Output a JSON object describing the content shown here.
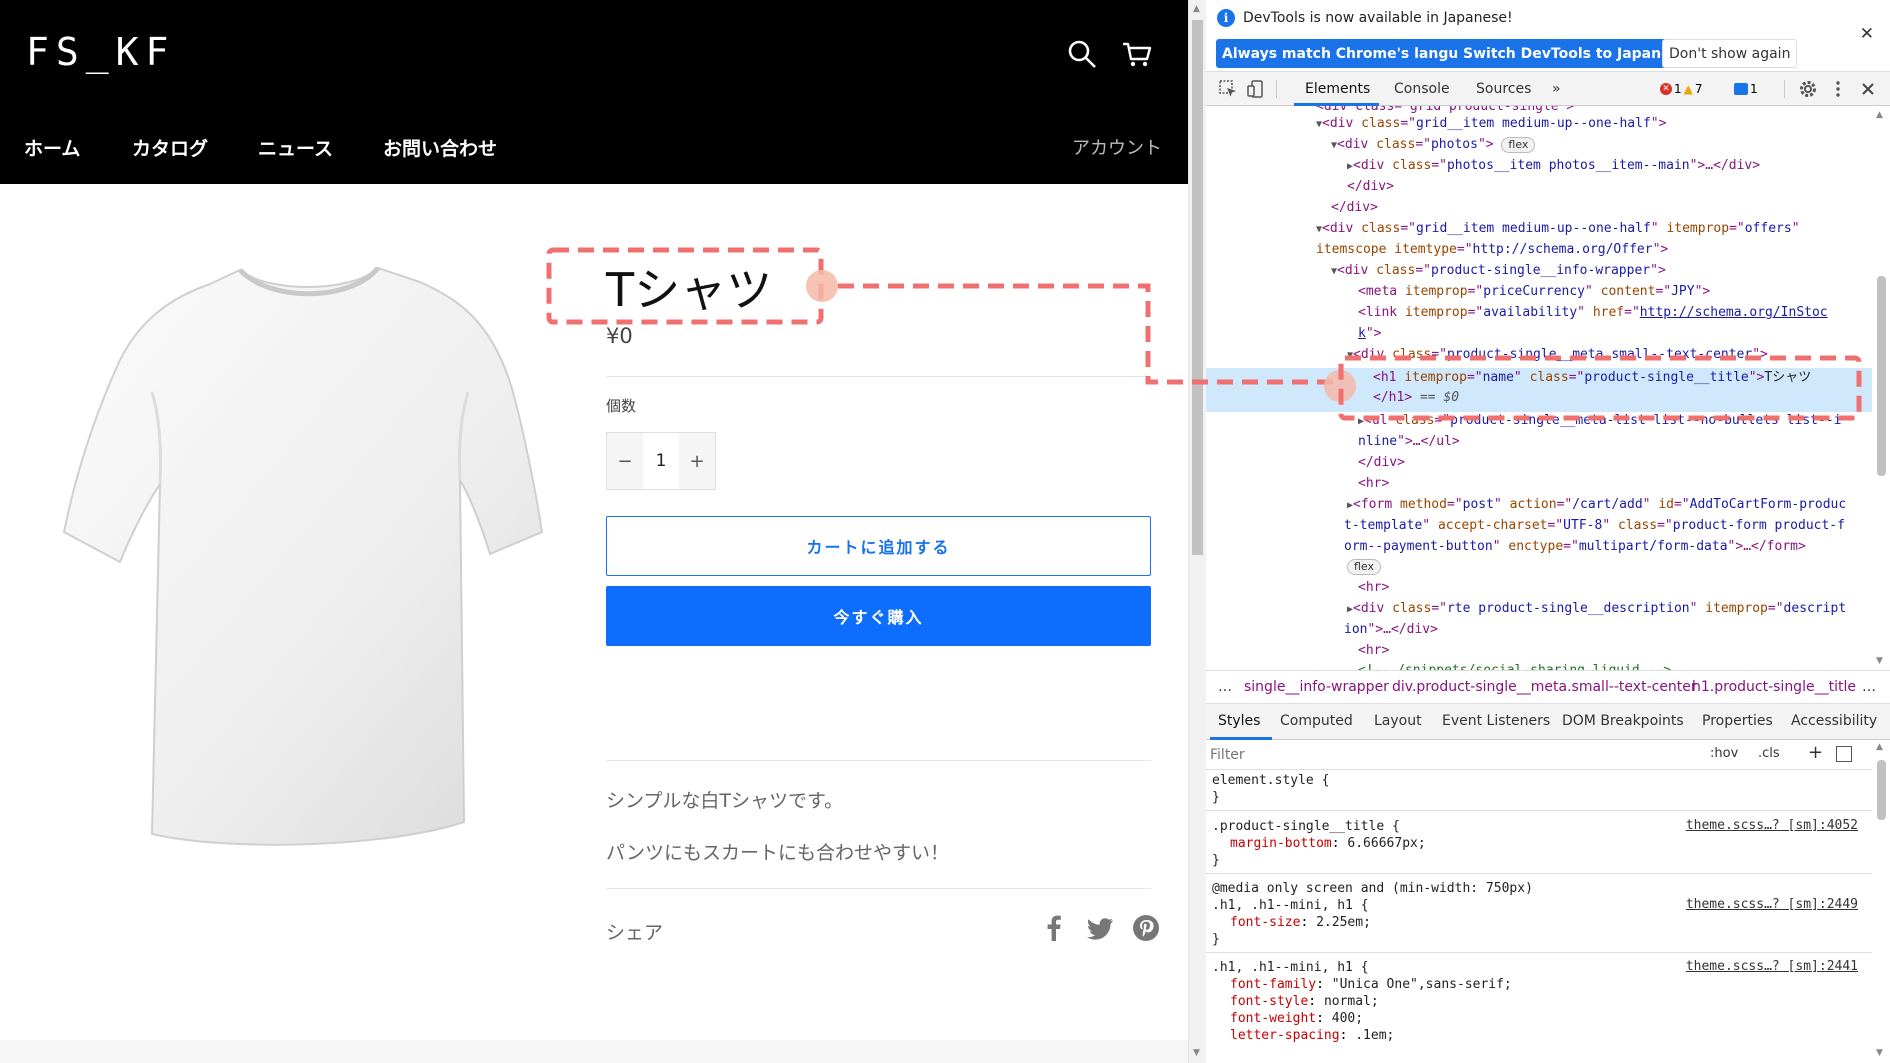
{
  "store": {
    "logo": "FS_KF",
    "nav": [
      "ホーム",
      "カタログ",
      "ニュース",
      "お問い合わせ"
    ],
    "account": "アカウント",
    "product": {
      "title": "Tシャツ",
      "price": "¥0",
      "quantity_label": "個数",
      "quantity_minus": "−",
      "quantity_value": "1",
      "quantity_plus": "+",
      "add_to_cart": "カートに追加する",
      "buy_now": "今すぐ購入",
      "description_1": "シンプルな白Tシャツです。",
      "description_2": "パンツにもスカートにも合わせやすい！",
      "share_label": "シェア"
    }
  },
  "devtools": {
    "infobar": {
      "message": "DevTools is now available in Japanese!",
      "buttons": [
        "Always match Chrome's language",
        "Switch DevTools to Japanese",
        "Don't show again"
      ]
    },
    "tabs": [
      "Elements",
      "Console",
      "Sources",
      "»"
    ],
    "badges": {
      "errors": "1",
      "warnings": "7",
      "messages": "1"
    },
    "breadcrumbs": [
      "…",
      "single__info-wrapper",
      "div.product-single__meta.small--text-center",
      "h1.product-single__title",
      "…"
    ],
    "sub_tabs": [
      "Styles",
      "Computed",
      "Layout",
      "Event Listeners",
      "DOM Breakpoints",
      "Properties",
      "Accessibility"
    ],
    "filter_placeholder": "Filter",
    "filter_tools": [
      ":hov",
      ".cls",
      "+"
    ],
    "dom": {
      "l0": "<div class=\"grid product-single\">",
      "l1_tag": "div",
      "l1_class": "grid__item medium-up--one-half",
      "l2_class": "photos",
      "flex": "flex",
      "l3_class": "photos__item photos__item--main",
      "l6_class": "grid__item medium-up--one-half",
      "l6_itemprop": "offers",
      "l7_itemtype": "http://schema.org/Offer",
      "l8_class": "product-single__info-wrapper",
      "l9_itemprop": "priceCurrency",
      "l9_content": "JPY",
      "l10_itemprop": "availability",
      "l10_href": "http://schema.org/InStoc",
      "l10_href2": "k",
      "l11_class": "product-single__meta small--text-center",
      "h1_itemprop": "name",
      "h1_class": "product-single__title",
      "h1_text": "Tシャツ",
      "h1_close": "== $0",
      "ul_class": "product-single__meta-list list--no-bullets list--i",
      "ul_class2": "nline",
      "form_method": "post",
      "form_action": "/cart/add",
      "form_id": "AddToCartForm-produc",
      "form_id2": "t-template",
      "form_charset": "UTF-8",
      "form_class": "product-form product-f",
      "form_class2": "orm--payment-button",
      "form_enctype": "multipart/form-data",
      "rte_class": "rte product-single__description",
      "rte_itemprop": "descript",
      "rte_itemprop2": "ion",
      "comment": "<!-- /snippets/social-sharing.liquid -->"
    },
    "styles": {
      "element_style": "element.style {",
      "rule1_selector": ".product-single__title {",
      "rule1_src": "theme.scss…? [sm]:4052",
      "rule1_prop": "margin-bottom",
      "rule1_val": "6.66667px;",
      "media": "@media only screen and (min-width: 750px)",
      "rule2_selector": ".h1, .h1--mini, h1 {",
      "rule2_src": "theme.scss…? [sm]:2449",
      "rule2_prop": "font-size",
      "rule2_val": "2.25em;",
      "rule3_selector": ".h1, .h1--mini, h1 {",
      "rule3_src": "theme.scss…? [sm]:2441",
      "rule3_props": [
        {
          "p": "font-family",
          "v": "\"Unica One\",sans-serif;"
        },
        {
          "p": "font-style",
          "v": "normal;"
        },
        {
          "p": "font-weight",
          "v": "400;"
        },
        {
          "p": "letter-spacing",
          "v": ".1em;"
        }
      ]
    }
  },
  "colors": {
    "accent": "#1a73e8",
    "buy_button": "#0d6efd",
    "annotation": "#f07070",
    "selection": "#cfe8fc"
  }
}
